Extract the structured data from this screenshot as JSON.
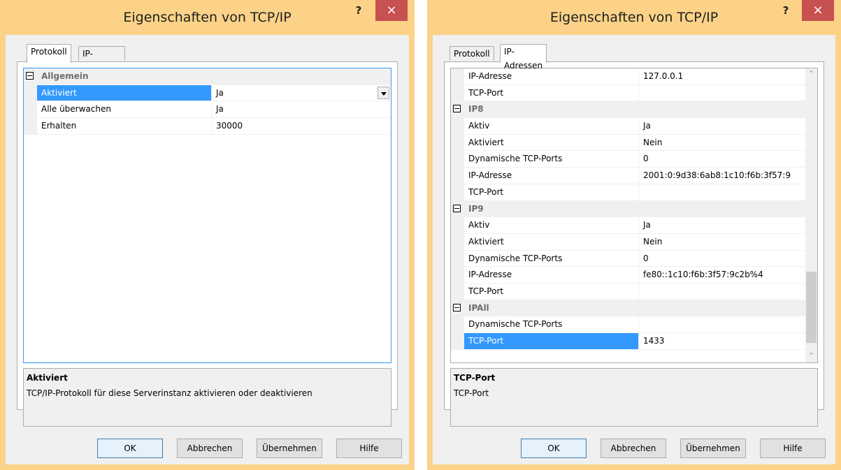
{
  "left": {
    "title": "Eigenschaften von TCP/IP",
    "help_label": "?",
    "close_label": "×",
    "tabs": [
      "Protokoll",
      "IP-Adressen"
    ],
    "grid": {
      "category": "Allgemein",
      "rows": [
        {
          "name": "Aktiviert",
          "value": "Ja"
        },
        {
          "name": "Alle überwachen",
          "value": "Ja"
        },
        {
          "name": "Erhalten",
          "value": "30000"
        }
      ]
    },
    "description": {
      "title": "Aktiviert",
      "text": "TCP/IP-Protokoll für diese Serverinstanz aktivieren oder deaktivieren"
    },
    "buttons": {
      "ok": "OK",
      "cancel": "Abbrechen",
      "apply": "Übernehmen",
      "help": "Hilfe"
    }
  },
  "right": {
    "title": "Eigenschaften von TCP/IP",
    "help_label": "?",
    "close_label": "×",
    "tabs": [
      "Protokoll",
      "IP-Adressen"
    ],
    "grid": {
      "rows": [
        {
          "type": "prop",
          "name": "IP-Adresse",
          "value": "127.0.0.1"
        },
        {
          "type": "prop",
          "name": "TCP-Port",
          "value": ""
        },
        {
          "type": "cat",
          "name": "IP8"
        },
        {
          "type": "prop",
          "name": "Aktiv",
          "value": "Ja"
        },
        {
          "type": "prop",
          "name": "Aktiviert",
          "value": "Nein"
        },
        {
          "type": "prop",
          "name": "Dynamische TCP-Ports",
          "value": "0"
        },
        {
          "type": "prop",
          "name": "IP-Adresse",
          "value": "2001:0:9d38:6ab8:1c10:f6b:3f57:9"
        },
        {
          "type": "prop",
          "name": "TCP-Port",
          "value": ""
        },
        {
          "type": "cat",
          "name": "IP9"
        },
        {
          "type": "prop",
          "name": "Aktiv",
          "value": "Ja"
        },
        {
          "type": "prop",
          "name": "Aktiviert",
          "value": "Nein"
        },
        {
          "type": "prop",
          "name": "Dynamische TCP-Ports",
          "value": "0"
        },
        {
          "type": "prop",
          "name": "IP-Adresse",
          "value": "fe80::1c10:f6b:3f57:9c2b%4"
        },
        {
          "type": "prop",
          "name": "TCP-Port",
          "value": ""
        },
        {
          "type": "cat",
          "name": "IPAll"
        },
        {
          "type": "prop",
          "name": "Dynamische TCP-Ports",
          "value": ""
        },
        {
          "type": "prop",
          "name": "TCP-Port",
          "value": "1433",
          "selected": true
        }
      ]
    },
    "description": {
      "title": "TCP-Port",
      "text": "TCP-Port"
    },
    "buttons": {
      "ok": "OK",
      "cancel": "Abbrechen",
      "apply": "Übernehmen",
      "help": "Hilfe"
    },
    "scroll_up_glyph": "˄",
    "scroll_down_glyph": "˅"
  },
  "colors": {
    "titlebar": "#fbd287",
    "close_button": "#c75050",
    "selection": "#3399ff",
    "grid_border": "#3399ff",
    "category_text": "#6d6d6d"
  }
}
